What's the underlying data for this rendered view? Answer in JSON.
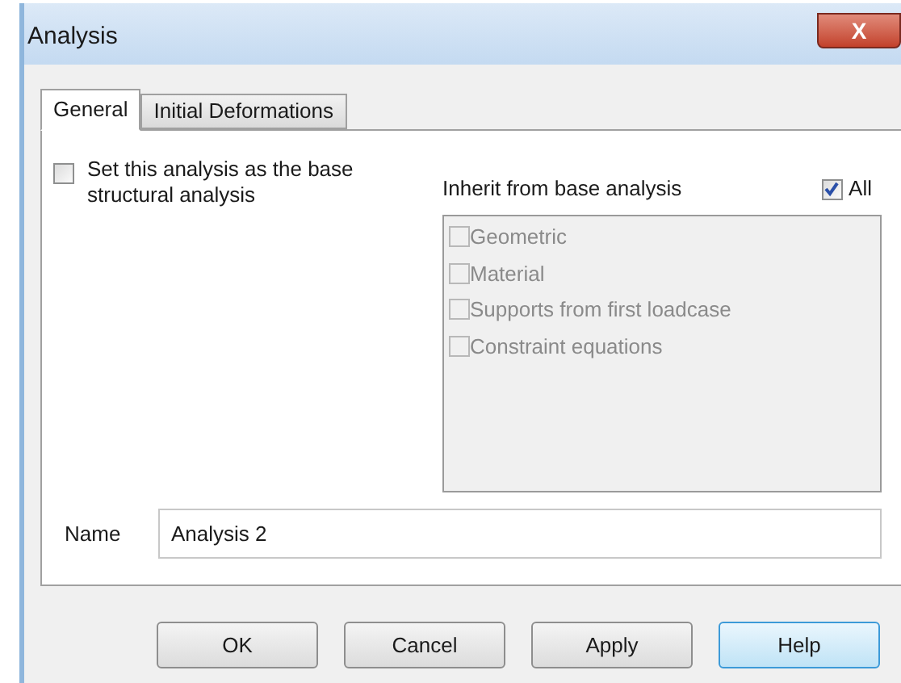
{
  "window": {
    "title": "Analysis",
    "close": "X"
  },
  "tabs": [
    {
      "label": "General",
      "selected": true
    },
    {
      "label": "Initial Deformations",
      "selected": false
    }
  ],
  "base_option": {
    "label": "Set this analysis as the base structural analysis",
    "checked": false
  },
  "inherit": {
    "label": "Inherit from base analysis",
    "all": {
      "label": "All",
      "checked": true
    },
    "items": [
      {
        "label": "Geometric",
        "checked": false,
        "disabled": true
      },
      {
        "label": "Material",
        "checked": false,
        "disabled": true
      },
      {
        "label": "Supports from first loadcase",
        "checked": false,
        "disabled": true
      },
      {
        "label": "Constraint equations",
        "checked": false,
        "disabled": true
      }
    ]
  },
  "name_field": {
    "label": "Name",
    "value": "Analysis 2"
  },
  "buttons": [
    {
      "label": "OK",
      "focused": false
    },
    {
      "label": "Cancel",
      "focused": false
    },
    {
      "label": "Apply",
      "focused": false
    },
    {
      "label": "Help",
      "focused": true
    }
  ]
}
